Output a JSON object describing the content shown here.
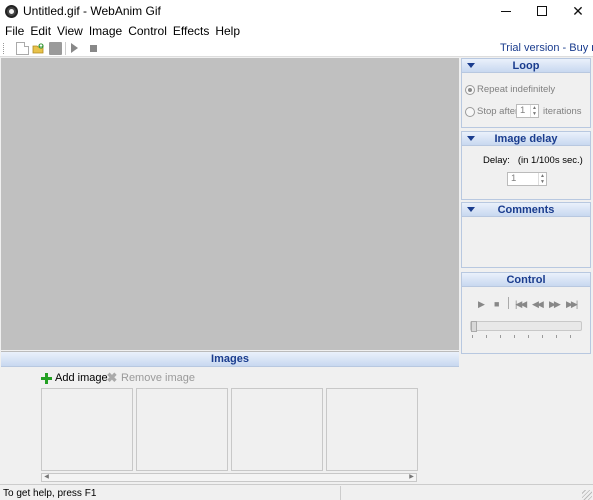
{
  "window": {
    "title": "Untitled.gif - WebAnim Gif"
  },
  "menu": [
    "File",
    "Edit",
    "View",
    "Image",
    "Control",
    "Effects",
    "Help"
  ],
  "toolbar": {
    "trial_link": "Trial version - Buy now!"
  },
  "images_panel": {
    "title": "Images",
    "add_label": "Add image",
    "remove_label": "Remove image"
  },
  "loop_panel": {
    "title": "Loop",
    "repeat_label": "Repeat indefinitely",
    "stop_after_label": "Stop after",
    "stop_after_value": "1",
    "iterations_label": "iterations",
    "selected_option": "repeat"
  },
  "delay_panel": {
    "title": "Image delay",
    "delay_label": "Delay:   (in 1/100s sec.)",
    "delay_value": "1"
  },
  "comments_panel": {
    "title": "Comments"
  },
  "control_panel": {
    "title": "Control",
    "slider_position": 0
  },
  "status": {
    "text": "To get help, press F1"
  },
  "colors": {
    "header_text": "#1a3c8e",
    "canvas_bg": "#c0c0c0",
    "add_icon": "#23a023"
  }
}
